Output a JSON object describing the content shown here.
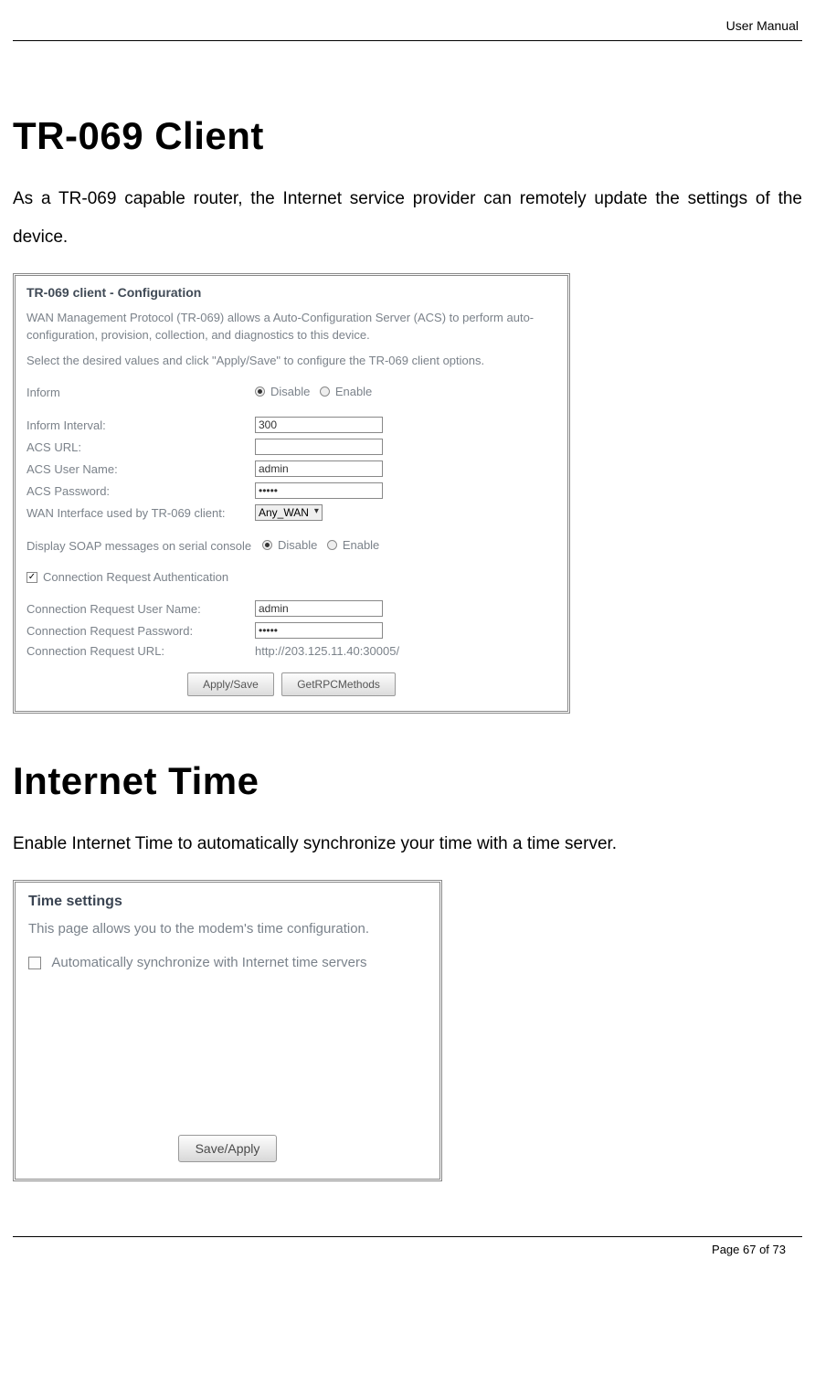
{
  "header": {
    "doc_label": "User Manual"
  },
  "section1": {
    "title": "TR-069 Client",
    "intro": "As a TR-069 capable router, the Internet service provider can remotely update the settings of the device."
  },
  "tr069": {
    "panel_title": "TR-069 client - Configuration",
    "desc1": "WAN Management Protocol (TR-069) allows a Auto-Configuration Server (ACS) to perform auto-configuration, provision, collection, and diagnostics to this device.",
    "desc2": "Select the desired values and click \"Apply/Save\" to configure the TR-069 client options.",
    "inform_label": "Inform",
    "inform_disable": "Disable",
    "inform_enable": "Enable",
    "interval_label": "Inform Interval:",
    "interval_value": "300",
    "acs_url_label": "ACS URL:",
    "acs_url_value": "",
    "acs_user_label": "ACS User Name:",
    "acs_user_value": "admin",
    "acs_pass_label": "ACS Password:",
    "acs_pass_value": "•••••",
    "wan_if_label": "WAN Interface used by TR-069 client:",
    "wan_if_value": "Any_WAN",
    "soap_label": "Display SOAP messages on serial console",
    "soap_disable": "Disable",
    "soap_enable": "Enable",
    "conn_auth_label": "Connection Request Authentication",
    "conn_user_label": "Connection Request User Name:",
    "conn_user_value": "admin",
    "conn_pass_label": "Connection Request Password:",
    "conn_pass_value": "•••••",
    "conn_url_label": "Connection Request URL:",
    "conn_url_value": "http://203.125.11.40:30005/",
    "btn_apply": "Apply/Save",
    "btn_rpc": "GetRPCMethods"
  },
  "section2": {
    "title": "Internet Time",
    "intro": "Enable Internet Time to automatically synchronize your time with a time server."
  },
  "timesettings": {
    "panel_title": "Time settings",
    "desc": "This page allows you to the modem's time configuration.",
    "auto_label": "Automatically synchronize with Internet time servers",
    "btn_save": "Save/Apply"
  },
  "footer": {
    "page": "Page 67 of 73"
  }
}
